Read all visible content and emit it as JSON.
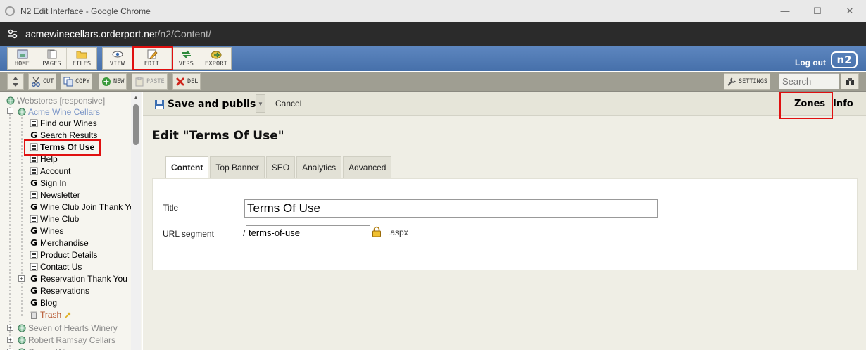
{
  "browser": {
    "window_title": "N2 Edit Interface - Google Chrome",
    "url_host": "acmewinecellars.orderport.net",
    "url_path": "/n2/Content/",
    "controls": {
      "minimize": "—",
      "maximize": "☐",
      "close": "✕"
    }
  },
  "toolbar": {
    "groups": [
      [
        {
          "label": "HOME",
          "icon": "home-icon"
        },
        {
          "label": "PAGES",
          "icon": "pages-icon"
        },
        {
          "label": "FILES",
          "icon": "folder-icon"
        }
      ],
      [
        {
          "label": "VIEW",
          "icon": "eye-icon"
        },
        {
          "label": "EDIT",
          "icon": "edit-icon"
        },
        {
          "label": "VERS",
          "icon": "versions-icon"
        },
        {
          "label": "EXPORT",
          "icon": "export-icon"
        }
      ]
    ],
    "logout_label": "Log out",
    "logo_text": "n2"
  },
  "actionbar": {
    "cut": "CUT",
    "copy": "COPY",
    "new": "NEW",
    "paste": "PASTE",
    "del": "DEL",
    "settings": "SETTINGS",
    "search_placeholder": "Search"
  },
  "tree": {
    "root": "Webstores [responsive]",
    "site": "Acme Wine Cellars",
    "items": [
      {
        "label": "Find our Wines",
        "icon": "page"
      },
      {
        "label": "Search Results",
        "icon": "g"
      },
      {
        "label": "Terms Of Use",
        "icon": "page",
        "selected": true
      },
      {
        "label": "Help",
        "icon": "page"
      },
      {
        "label": "Account",
        "icon": "page"
      },
      {
        "label": "Sign In",
        "icon": "g"
      },
      {
        "label": "Newsletter",
        "icon": "page"
      },
      {
        "label": "Wine Club Join Thank Yo",
        "icon": "g"
      },
      {
        "label": "Wine Club",
        "icon": "page"
      },
      {
        "label": "Wines",
        "icon": "g"
      },
      {
        "label": "Merchandise",
        "icon": "g"
      },
      {
        "label": "Product Details",
        "icon": "page"
      },
      {
        "label": "Contact Us",
        "icon": "page"
      },
      {
        "label": "Reservation Thank You",
        "icon": "g",
        "expandable": true
      },
      {
        "label": "Reservations",
        "icon": "g"
      },
      {
        "label": "Blog",
        "icon": "g"
      },
      {
        "label": "Trash",
        "icon": "trash"
      }
    ],
    "other_sites": [
      "Seven of Hearts Winery",
      "Robert Ramsay Cellars",
      "Carver Wines"
    ]
  },
  "editor": {
    "save_label": "Save and publish",
    "cancel_label": "Cancel",
    "zones_label": "Zones",
    "info_label": "Info",
    "page_title": "Edit \"Terms Of Use\"",
    "tabs": [
      "Content",
      "Top Banner",
      "SEO",
      "Analytics",
      "Advanced"
    ],
    "active_tab": "Content",
    "fields": {
      "title_label": "Title",
      "title_value": "Terms Of Use",
      "url_label": "URL segment",
      "url_prefix": "/",
      "url_value": "terms-of-use",
      "url_suffix": ".aspx"
    }
  },
  "colors": {
    "toolbar_blue": "#5178b5",
    "highlight_red": "#e01010",
    "tree_bg": "#f6f5ef",
    "trash_text": "#b5562e"
  }
}
